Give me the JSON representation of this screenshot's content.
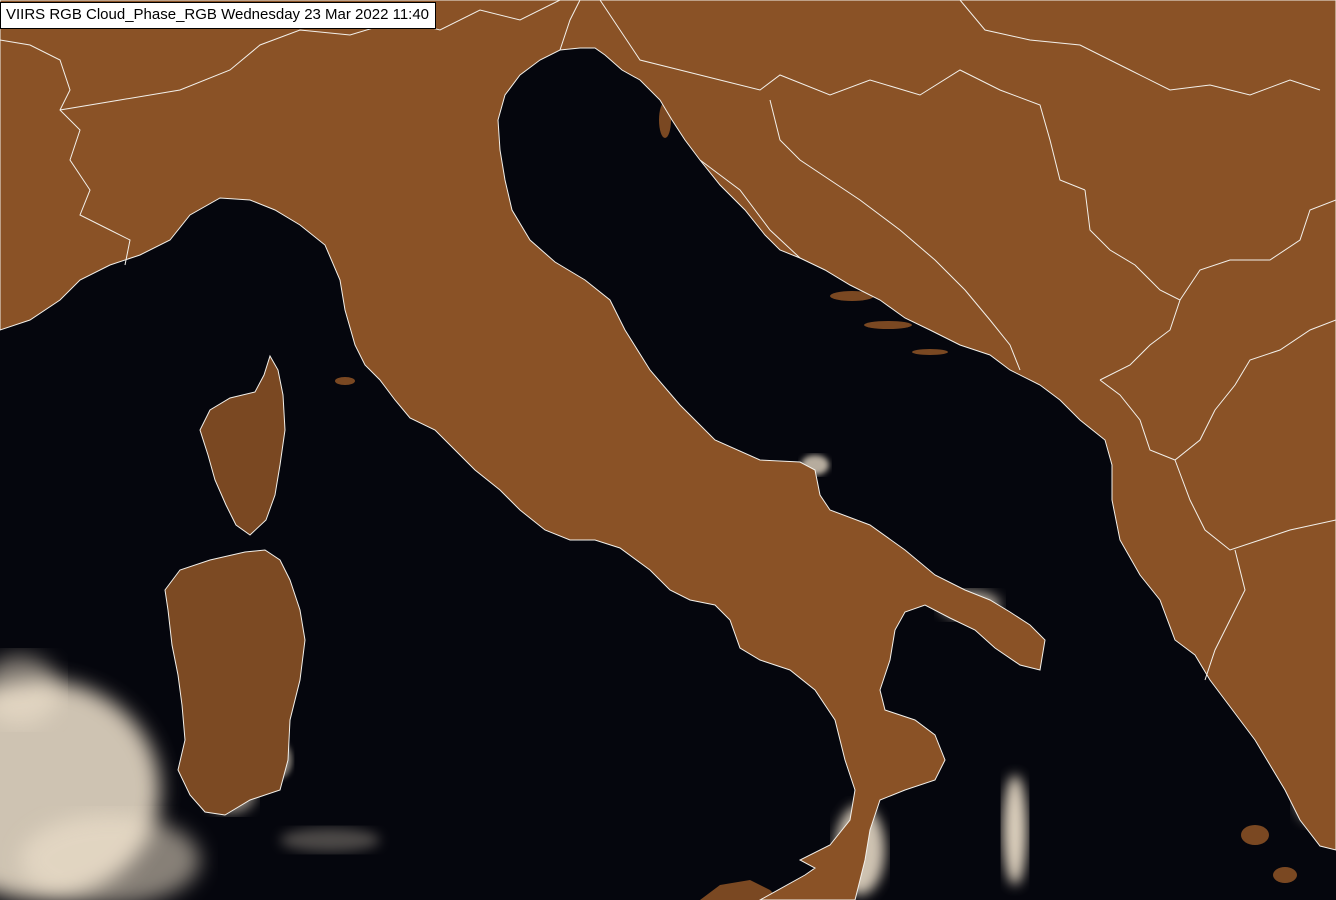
{
  "image": {
    "caption": "VIIRS RGB Cloud_Phase_RGB Wednesday 23 Mar 2022 11:40",
    "colors": {
      "sea": "#05060d",
      "land": "#8a5226",
      "land_dark": "#5a3416",
      "land_light": "#a86b32",
      "plains": "#9a7a30",
      "snow": "#2b2ee6",
      "cloud": "#f2e4cf",
      "border": "#f3f0ea"
    }
  }
}
